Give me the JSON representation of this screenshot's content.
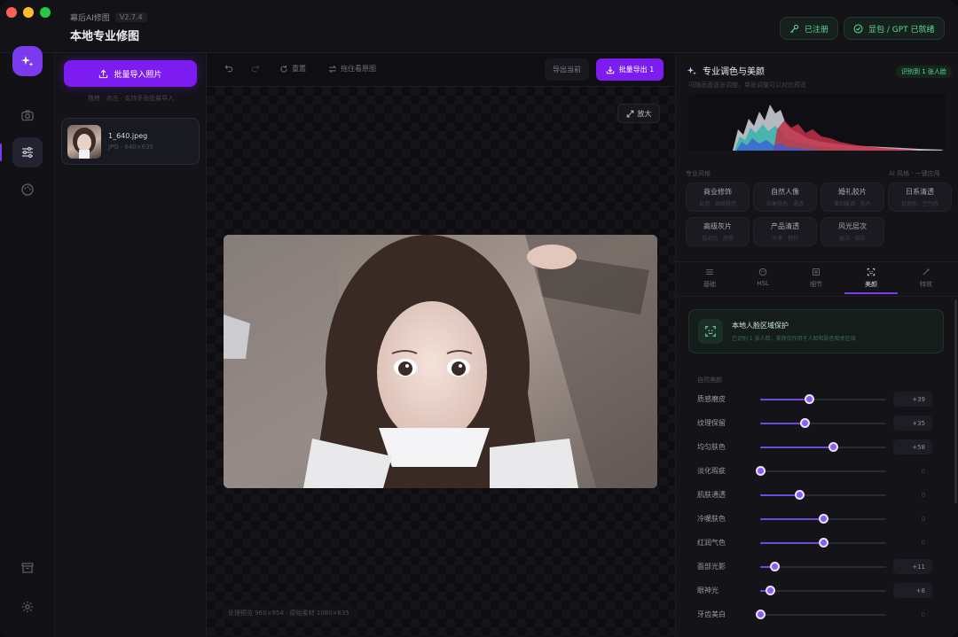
{
  "titlebar": {
    "app_name": "幕后AI修图",
    "version": "V2.7.4",
    "title": "本地专业修图",
    "register_label": "已注册",
    "gpt_label": "显包 / GPT 已就绪"
  },
  "files": {
    "import_label": "批量导入照片",
    "import_hint": "拖拽 · 点击 · 支持多张批量导入",
    "items": [
      {
        "name": "1_640.jpeg",
        "meta": "JPG · 640×635"
      }
    ]
  },
  "toolbar": {
    "reset_label": "重置",
    "compare_label": "拖住看原图",
    "export_current_label": "导出当前",
    "batch_export_label": "批量导出 1"
  },
  "stage": {
    "zoom_label": "放大",
    "info": "处理预览 960×954 · 原始素材 1080×635"
  },
  "right": {
    "title": "专业调色与美颜",
    "subtitle": "可随画面逐张调整，单张调整可以对比预览",
    "badge": "识别到 1 张人脸",
    "presets_label": "专业风格",
    "presets_right": "AI 风格 · 一键应用",
    "presets": [
      {
        "name": "商业修饰",
        "desc": "自然 · 高级质感"
      },
      {
        "name": "自然人像",
        "desc": "均衡肤色 · 通透"
      },
      {
        "name": "婚礼胶片",
        "desc": "柔和暖调 · 胶片"
      },
      {
        "name": "日系清透",
        "desc": "低饱和 · 空气感"
      },
      {
        "name": "高级灰片",
        "desc": "低对比 · 质感"
      },
      {
        "name": "产品清透",
        "desc": "干净 · 锐利"
      },
      {
        "name": "风光层次",
        "desc": "层次 · 细节"
      }
    ],
    "tabs": [
      {
        "label": "基础",
        "icon": "sliders-icon"
      },
      {
        "label": "HSL",
        "icon": "palette-icon"
      },
      {
        "label": "细节",
        "icon": "detail-icon"
      },
      {
        "label": "美颜",
        "icon": "face-scan-icon"
      },
      {
        "label": "特效",
        "icon": "magic-wand-icon"
      }
    ],
    "active_tab": "美颜",
    "protect_title": "本地人脸区域保护",
    "protect_desc": "已识别 1 张人脸，美颜仅作用于人脸和肤色相关区域",
    "section_label": "自然美颜",
    "sliders": [
      {
        "label": "质感磨皮",
        "value": "+39",
        "level": 0.39
      },
      {
        "label": "纹理保留",
        "value": "+35",
        "level": 0.35
      },
      {
        "label": "均匀肤色",
        "value": "+58",
        "level": 0.58
      },
      {
        "label": "淡化瑕疵",
        "value": "0",
        "level": 0
      },
      {
        "label": "肌肤通透",
        "value": "0",
        "level": 0.31
      },
      {
        "label": "冷暖肤色",
        "value": "0",
        "level": 0.5
      },
      {
        "label": "红润气色",
        "value": "0",
        "level": 0.5
      },
      {
        "label": "面部光影",
        "value": "+11",
        "level": 0.11
      },
      {
        "label": "眼神光",
        "value": "+8",
        "level": 0.08
      },
      {
        "label": "牙齿美白",
        "value": "0",
        "level": 0
      }
    ]
  },
  "colors": {
    "accent": "#7c3aed",
    "accent_button": "#7c1cf0",
    "ready_green": "#5fd79a"
  }
}
